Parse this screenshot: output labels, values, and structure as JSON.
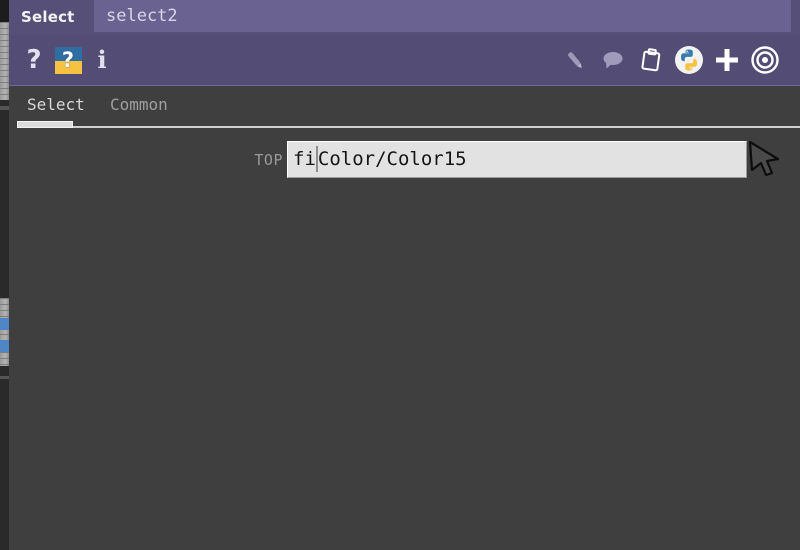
{
  "window": {
    "module_label": "Select",
    "instance_name": "select2"
  },
  "toolbar": {
    "left_buttons": [
      {
        "name": "help-question-button",
        "icon": "question-mark-icon",
        "label": "?"
      },
      {
        "name": "whats-this-button",
        "icon": "whats-this-icon",
        "label": "?"
      },
      {
        "name": "info-button",
        "icon": "info-icon",
        "label": "i"
      }
    ],
    "right_buttons": [
      {
        "name": "edit-button",
        "icon": "pencil-icon",
        "label": ""
      },
      {
        "name": "comment-button",
        "icon": "speech-bubble-icon",
        "label": ""
      },
      {
        "name": "clipboard-button",
        "icon": "clipboard-icon",
        "label": ""
      },
      {
        "name": "python-button",
        "icon": "python-logo-icon",
        "label": ""
      },
      {
        "name": "add-button",
        "icon": "plus-icon",
        "label": ""
      },
      {
        "name": "target-button",
        "icon": "target-icon",
        "label": ""
      }
    ]
  },
  "tabs": [
    {
      "label": "Select",
      "active": true
    },
    {
      "label": "Common",
      "active": false
    }
  ],
  "form": {
    "top_field": {
      "label": "TOP",
      "value_before_caret": "fi",
      "value_after_caret": "Color/Color15",
      "value": "fiColor/Color15",
      "placeholder": ""
    }
  },
  "colors": {
    "titlebar": "#564f78",
    "titlebar_field": "#6a6392",
    "toolbar": "#534c74",
    "body": "#3f3f3f",
    "input_bg": "#e2e2e2",
    "tab_active_text": "#d8d8d8",
    "tab_inactive_text": "#9fa0a0",
    "accent_underline": "#dcdcdc"
  }
}
